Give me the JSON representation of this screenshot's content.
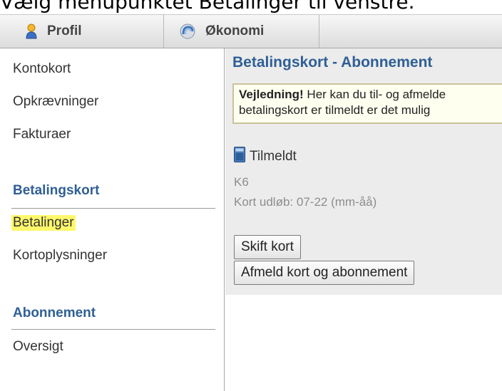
{
  "caption": "Vælg menupunktet Betalinger til venstre.",
  "tabs": [
    {
      "label": "Profil",
      "icon": "user-icon"
    },
    {
      "label": "Økonomi",
      "icon": "spiral-icon"
    }
  ],
  "sidebar": {
    "top_links": [
      "Kontokort",
      "Opkrævninger",
      "Fakturaer"
    ],
    "section1": {
      "heading": "Betalingskort",
      "links": [
        "Betalinger",
        "Kortoplysninger"
      ]
    },
    "section2": {
      "heading": "Abonnement",
      "links": [
        "Oversigt"
      ]
    }
  },
  "main": {
    "title": "Betalingskort - Abonnement",
    "guide": {
      "bold": "Vejledning!",
      "line1_rest": " Her kan du til- og afmelde",
      "line2": "betalingskort er tilmeldt er det mulig"
    },
    "card": {
      "icon": "card-icon",
      "status": "Tilmeldt",
      "name": "K6",
      "expiry": "Kort udløb: 07-22 (mm-åå)"
    },
    "buttons": {
      "change_card": "Skift kort",
      "unsubscribe": "Afmeld kort og abonnement"
    }
  },
  "colors": {
    "heading": "#2f5f95",
    "highlight": "#fff86b",
    "content_bg": "#ececec"
  }
}
